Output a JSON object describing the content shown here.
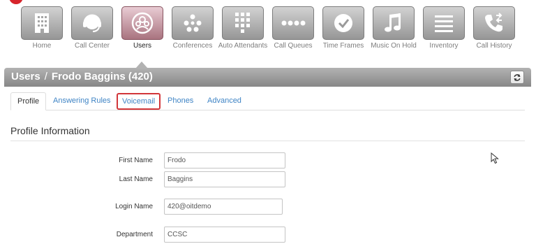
{
  "nav": {
    "tiles": [
      {
        "label": "Home",
        "icon": "building-icon"
      },
      {
        "label": "Call Center",
        "icon": "headset-icon"
      },
      {
        "label": "Users",
        "icon": "users-icon"
      },
      {
        "label": "Conferences",
        "icon": "conference-icon"
      },
      {
        "label": "Auto Attendants",
        "icon": "keypad-icon"
      },
      {
        "label": "Call Queues",
        "icon": "queue-dots-icon"
      },
      {
        "label": "Time Frames",
        "icon": "clock-icon"
      },
      {
        "label": "Music On Hold",
        "icon": "music-note-icon"
      },
      {
        "label": "Inventory",
        "icon": "list-icon"
      },
      {
        "label": "Call History",
        "icon": "phone-history-icon"
      }
    ],
    "active": "Users"
  },
  "header": {
    "section": "Users",
    "separator": "/",
    "subject": "Frodo Baggins (420)",
    "refresh_icon": "refresh-icon"
  },
  "tabs": [
    {
      "label": "Profile"
    },
    {
      "label": "Answering Rules"
    },
    {
      "label": "Voicemail"
    },
    {
      "label": "Phones"
    },
    {
      "label": "Advanced"
    }
  ],
  "profile": {
    "title": "Profile Information",
    "fields": {
      "first_name": {
        "label": "First Name",
        "value": "Frodo"
      },
      "last_name": {
        "label": "Last Name",
        "value": "Baggins"
      },
      "login_name": {
        "label": "Login Name",
        "value": "420@oitdemo"
      },
      "department": {
        "label": "Department",
        "value": "CCSC"
      }
    }
  },
  "colors": {
    "brand_red": "#d7252b",
    "link_blue": "#3f84c5",
    "highlight_red": "#d2363a",
    "active_tile": "#a9737f"
  }
}
